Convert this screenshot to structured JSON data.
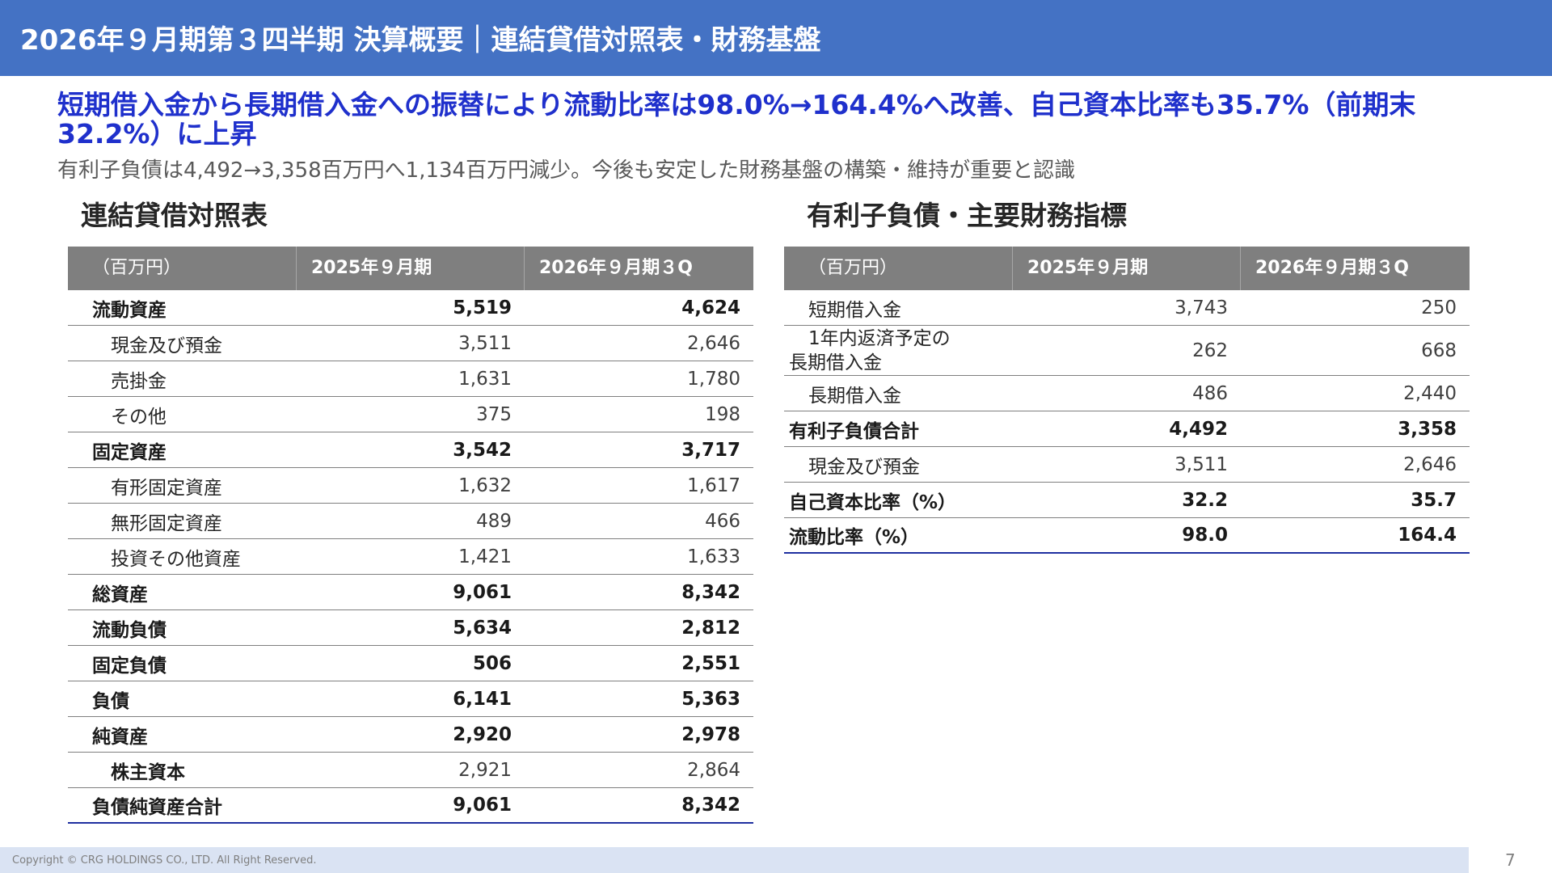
{
  "header": {
    "title": "2026年９月期第３四半期 決算概要｜連結貸借対照表・財務基盤"
  },
  "headline": "短期借入金から長期借入金への振替により流動比率は98.0%→164.4%へ改善、自己資本比率も35.7%（前期末32.2%）に上昇",
  "subline": "有利子負債は4,492→3,358百万円へ1,134百万円減少。今後も安定した財務基盤の構築・維持が重要と認識",
  "balance_sheet": {
    "title": "連結貸借対照表",
    "columns": [
      "（百万円）",
      "2025年９月期",
      "2026年９月期３Q"
    ],
    "rows": [
      {
        "label": "流動資産",
        "v2025": "5,519",
        "v2026": "4,624"
      },
      {
        "label": "現金及び預金",
        "v2025": "3,511",
        "v2026": "2,646"
      },
      {
        "label": "売掛金",
        "v2025": "1,631",
        "v2026": "1,780"
      },
      {
        "label": "その他",
        "v2025": "375",
        "v2026": "198"
      },
      {
        "label": "固定資産",
        "v2025": "3,542",
        "v2026": "3,717"
      },
      {
        "label": "有形固定資産",
        "v2025": "1,632",
        "v2026": "1,617"
      },
      {
        "label": "無形固定資産",
        "v2025": "489",
        "v2026": "466"
      },
      {
        "label": "投資その他資産",
        "v2025": "1,421",
        "v2026": "1,633"
      },
      {
        "label": "総資産",
        "v2025": "9,061",
        "v2026": "8,342"
      },
      {
        "label": "流動負債",
        "v2025": "5,634",
        "v2026": "2,812"
      },
      {
        "label": "固定負債",
        "v2025": "506",
        "v2026": "2,551"
      },
      {
        "label": "負債",
        "v2025": "6,141",
        "v2026": "5,363"
      },
      {
        "label": "純資産",
        "v2025": "2,920",
        "v2026": "2,978"
      },
      {
        "label": "株主資本",
        "v2025": "2,921",
        "v2026": "2,864"
      },
      {
        "label": "負債純資産合計",
        "v2025": "9,061",
        "v2026": "8,342"
      }
    ]
  },
  "debt_table": {
    "title": "有利子負債・主要財務指標",
    "columns": [
      "（百万円）",
      "2025年９月期",
      "2026年９月期３Q"
    ],
    "rows": [
      {
        "label": "短期借入金",
        "v2025": "3,743",
        "v2026": "250"
      },
      {
        "label": "1年内返済予定の長期借入金",
        "v2025": "262",
        "v2026": "668"
      },
      {
        "label": "長期借入金",
        "v2025": "486",
        "v2026": "2,440"
      },
      {
        "label": "有利子負債合計",
        "v2025": "4,492",
        "v2026": "3,358"
      },
      {
        "label": "現金及び預金",
        "v2025": "3,511",
        "v2026": "2,646"
      },
      {
        "label": "自己資本比率（%）",
        "v2025": "32.2",
        "v2026": "35.7"
      },
      {
        "label": "流動比率（%）",
        "v2025": "98.0",
        "v2026": "164.4"
      }
    ]
  },
  "footer": {
    "copyright": "Copyright © CRG HOLDINGS CO., LTD. All Right Reserved.",
    "page_number": "7"
  }
}
